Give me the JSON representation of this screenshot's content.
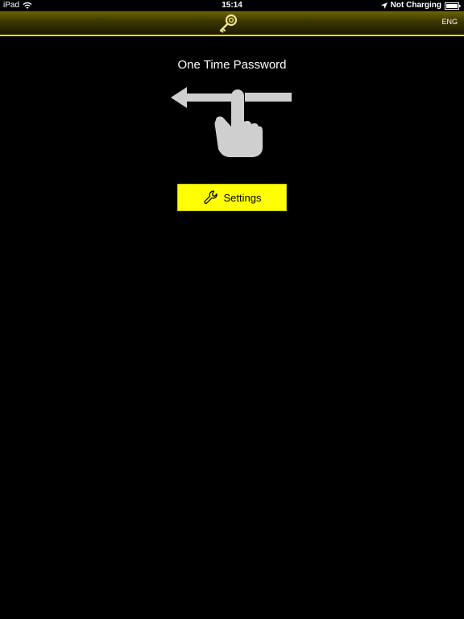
{
  "status_bar": {
    "device": "iPad",
    "time": "15:14",
    "charging": "Not Charging",
    "icons": [
      "wifi-icon",
      "location-icon",
      "battery-icon"
    ]
  },
  "nav_bar": {
    "logo_icon": "key-logo-icon",
    "language": "ENG",
    "accent_color": "#e8df00"
  },
  "main": {
    "title": "One Time Password",
    "swipe_hint_icon": "swipe-left-hand-icon",
    "settings_label": "Settings",
    "settings_icon": "wrench-icon",
    "button_color": "#ffff00"
  }
}
